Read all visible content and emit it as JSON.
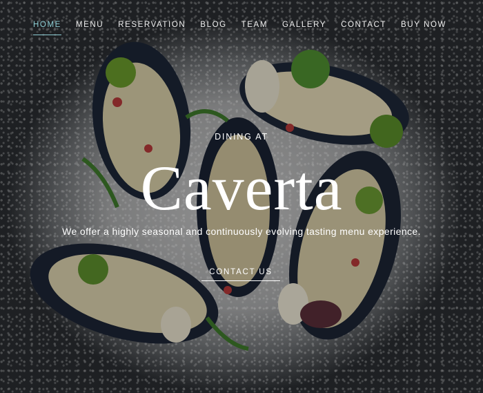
{
  "nav": {
    "items": [
      {
        "label": "HOME",
        "active": true
      },
      {
        "label": "MENU"
      },
      {
        "label": "RESERVATION"
      },
      {
        "label": "BLOG"
      },
      {
        "label": "TEAM"
      },
      {
        "label": "GALLERY"
      },
      {
        "label": "CONTACT"
      },
      {
        "label": "BUY NOW"
      }
    ]
  },
  "hero": {
    "pre_title": "DINING AT",
    "title": "Caverta",
    "tagline": "We offer a highly seasonal and continuously evolving tasting menu experience.",
    "cta_label": "CONTACT US",
    "background_image": "mussels-dish-on-salt"
  },
  "colors": {
    "active_nav": "#8fd0d6",
    "text": "#ffffff",
    "background": "#1f2226"
  }
}
